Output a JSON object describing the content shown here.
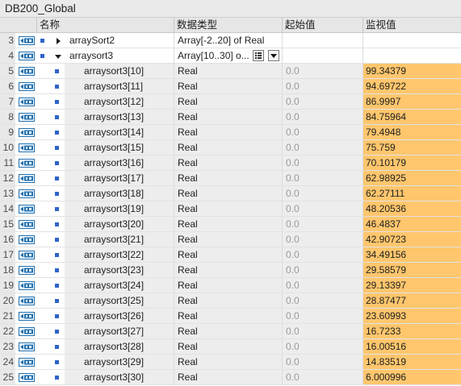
{
  "window": {
    "title": "DB200_Global"
  },
  "columns": {
    "name": "名称",
    "datatype": "数据类型",
    "start_value": "起始值",
    "monitor_value": "监视值"
  },
  "colors": {
    "monitor_highlight": "#ffc66d",
    "bullet": "#2e63c9",
    "io_icon": "#1f6fb0"
  },
  "rows": [
    {
      "index": "3",
      "name": "arraySort2",
      "type": "Array[-2..20] of Real",
      "start": "",
      "monitor": "",
      "kind": "parent",
      "expanded": false
    },
    {
      "index": "4",
      "name": "arraysort3",
      "type": "Array[10..30] o...",
      "start": "",
      "monitor": "",
      "kind": "parent",
      "expanded": true
    },
    {
      "index": "5",
      "name": "arraysort3[10]",
      "type": "Real",
      "start": "0.0",
      "monitor": "99.34379",
      "kind": "child"
    },
    {
      "index": "6",
      "name": "arraysort3[11]",
      "type": "Real",
      "start": "0.0",
      "monitor": "94.69722",
      "kind": "child"
    },
    {
      "index": "7",
      "name": "arraysort3[12]",
      "type": "Real",
      "start": "0.0",
      "monitor": "86.9997",
      "kind": "child"
    },
    {
      "index": "8",
      "name": "arraysort3[13]",
      "type": "Real",
      "start": "0.0",
      "monitor": "84.75964",
      "kind": "child"
    },
    {
      "index": "9",
      "name": "arraysort3[14]",
      "type": "Real",
      "start": "0.0",
      "monitor": "79.4948",
      "kind": "child"
    },
    {
      "index": "10",
      "name": "arraysort3[15]",
      "type": "Real",
      "start": "0.0",
      "monitor": "75.759",
      "kind": "child"
    },
    {
      "index": "11",
      "name": "arraysort3[16]",
      "type": "Real",
      "start": "0.0",
      "monitor": "70.10179",
      "kind": "child"
    },
    {
      "index": "12",
      "name": "arraysort3[17]",
      "type": "Real",
      "start": "0.0",
      "monitor": "62.98925",
      "kind": "child"
    },
    {
      "index": "13",
      "name": "arraysort3[18]",
      "type": "Real",
      "start": "0.0",
      "monitor": "62.27111",
      "kind": "child"
    },
    {
      "index": "14",
      "name": "arraysort3[19]",
      "type": "Real",
      "start": "0.0",
      "monitor": "48.20536",
      "kind": "child"
    },
    {
      "index": "15",
      "name": "arraysort3[20]",
      "type": "Real",
      "start": "0.0",
      "monitor": "46.4837",
      "kind": "child"
    },
    {
      "index": "16",
      "name": "arraysort3[21]",
      "type": "Real",
      "start": "0.0",
      "monitor": "42.90723",
      "kind": "child"
    },
    {
      "index": "17",
      "name": "arraysort3[22]",
      "type": "Real",
      "start": "0.0",
      "monitor": "34.49156",
      "kind": "child"
    },
    {
      "index": "18",
      "name": "arraysort3[23]",
      "type": "Real",
      "start": "0.0",
      "monitor": "29.58579",
      "kind": "child"
    },
    {
      "index": "19",
      "name": "arraysort3[24]",
      "type": "Real",
      "start": "0.0",
      "monitor": "29.13397",
      "kind": "child"
    },
    {
      "index": "20",
      "name": "arraysort3[25]",
      "type": "Real",
      "start": "0.0",
      "monitor": "28.87477",
      "kind": "child"
    },
    {
      "index": "21",
      "name": "arraysort3[26]",
      "type": "Real",
      "start": "0.0",
      "monitor": "23.60993",
      "kind": "child"
    },
    {
      "index": "22",
      "name": "arraysort3[27]",
      "type": "Real",
      "start": "0.0",
      "monitor": "16.7233",
      "kind": "child"
    },
    {
      "index": "23",
      "name": "arraysort3[28]",
      "type": "Real",
      "start": "0.0",
      "monitor": "16.00516",
      "kind": "child"
    },
    {
      "index": "24",
      "name": "arraysort3[29]",
      "type": "Real",
      "start": "0.0",
      "monitor": "14.83519",
      "kind": "child"
    },
    {
      "index": "25",
      "name": "arraysort3[30]",
      "type": "Real",
      "start": "0.0",
      "monitor": "6.000996",
      "kind": "child"
    }
  ]
}
